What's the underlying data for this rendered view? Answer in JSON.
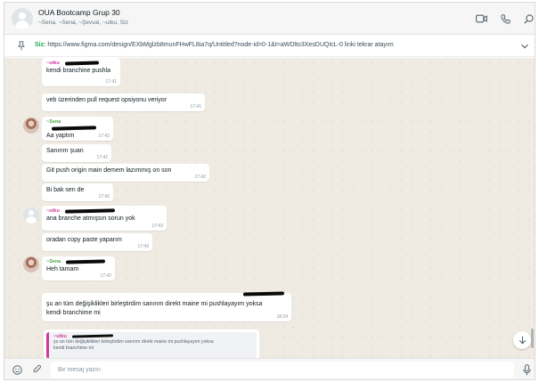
{
  "header": {
    "group_name": "OUA Bootcamp Grup 30",
    "members": "~Sena, ~Sena, ~Şevval, ~utku, Siz"
  },
  "pinned": {
    "author": "Siz:",
    "text": "https://www.figma.com/design/EXbMglzb8munFHwFL8ia7q/Untitled?node-id=0-1&t=aWDlto3XesDUQIcL-0 linki tekrar atayım"
  },
  "messages": [
    {
      "sender": "~utku",
      "text": "kendi branchine pushla",
      "time": "17:41"
    },
    {
      "text": "veb üzerinden pull request opsiyonu veriyor",
      "time": "17:41"
    },
    {
      "sender": "~Sena",
      "text": "Aa yaptım",
      "time": "17:42"
    },
    {
      "text": "Sanırım şuan",
      "time": "17:42"
    },
    {
      "text": "Git push origin main demem lazımmış on son",
      "time": "17:42"
    },
    {
      "text": "Bi bak sen de",
      "time": "17:42"
    },
    {
      "sender": "~utku",
      "text": "ana branche atmışsın sorun yok",
      "time": "17:43"
    },
    {
      "text": "oradan copy paste yaparım",
      "time": "17:43"
    },
    {
      "sender": "~Sena",
      "text": "Heh tamam",
      "time": "17:42"
    },
    {
      "text_line1": "şu an tüm değişiklikleri birleştirdim sanırım direkt maine mi pushlayayım yoksa",
      "text_line2": "kendi branchime mi",
      "time": "18:24"
    }
  ],
  "quote": {
    "sender": "~utku",
    "line1": "şu an tüm değişiklikleri birleştirdim sanırım direkt maine mi pushlayayım yoksa",
    "line2": "kendi branchime mi"
  },
  "composer": {
    "placeholder": "Bir mesaj yazın"
  },
  "colors": {
    "chat_bg": "#efeae2",
    "sender_sena": "#4fa34b",
    "sender_utku": "#d03a9a",
    "pin_author": "#1fa855"
  }
}
